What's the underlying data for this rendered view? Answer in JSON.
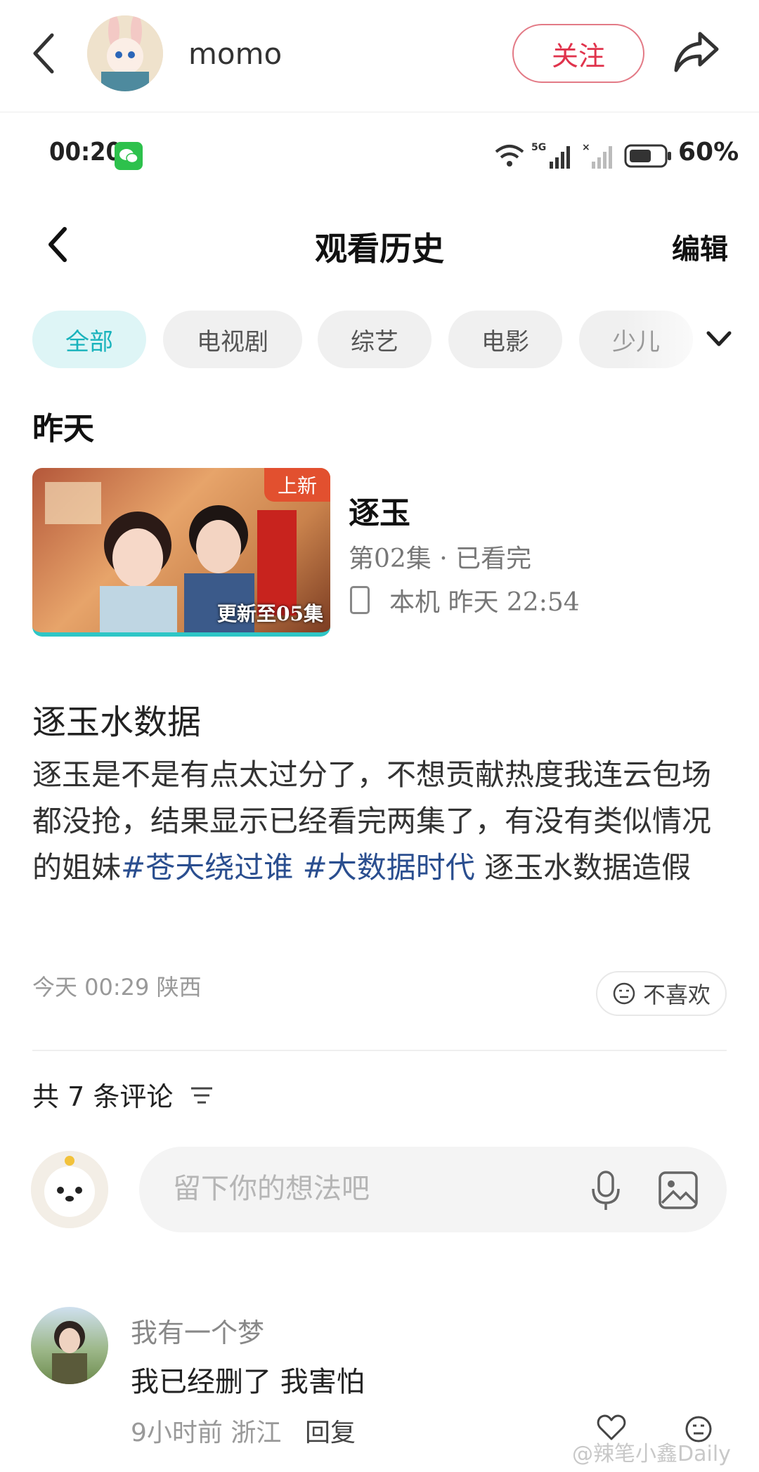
{
  "header": {
    "username": "momo",
    "follow_label": "关注"
  },
  "embedded": {
    "status_time": "00:20",
    "battery": "60%",
    "nav_title": "观看历史",
    "edit_label": "编辑",
    "chips": [
      "全部",
      "电视剧",
      "综艺",
      "电影",
      "少儿"
    ],
    "section_label": "昨天",
    "item": {
      "badge": "上新",
      "update": "更新至05集",
      "title": "逐玉",
      "episode": "第02集 · 已看完",
      "device": "本机   昨天 22:54"
    }
  },
  "post": {
    "title": "逐玉水数据",
    "body_1": "逐玉是不是有点太过分了，不想贡献热度我连云包场都没抢，结果显示已经看完两集了，有没有类似情况的姐妹",
    "hashtag_1": "#苍天绕过谁",
    "hashtag_2": "#大数据时代",
    "body_2": " 逐玉水数据造假",
    "meta": "今天 00:29 陕西",
    "dislike_label": "不喜欢"
  },
  "comments": {
    "count_label": "共 7 条评论",
    "input_placeholder": "留下你的想法吧",
    "items": [
      {
        "name": "我有一个梦",
        "text": "我已经删了 我害怕",
        "meta": "9小时前 浙江",
        "reply_label": "回复"
      }
    ]
  },
  "watermark": "@辣笔小鑫Daily"
}
